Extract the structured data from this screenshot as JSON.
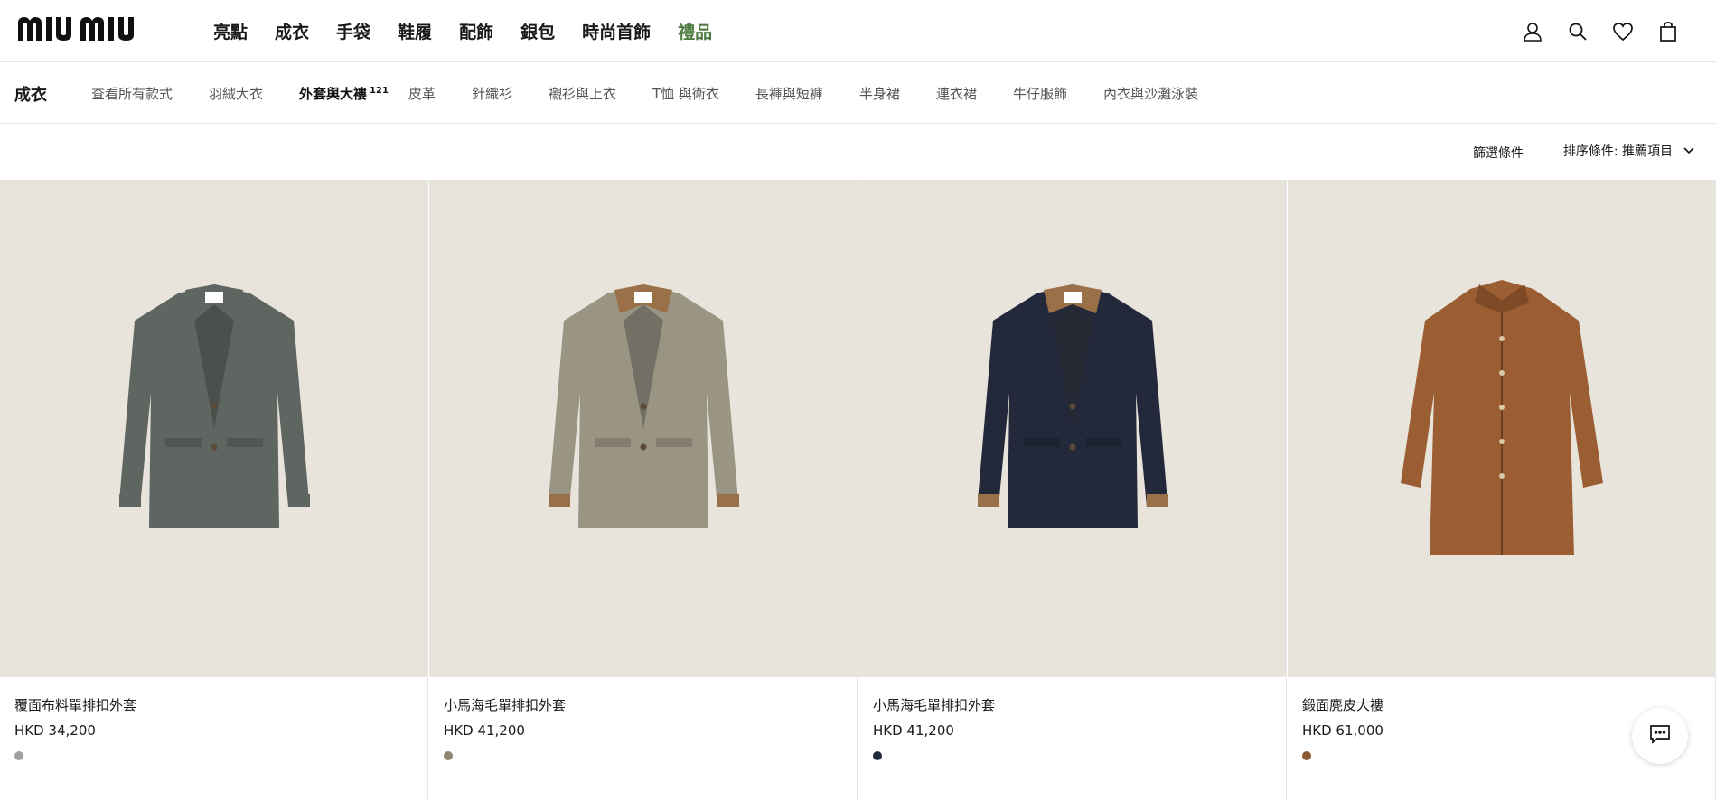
{
  "header": {
    "logo_text": "MIU MIU",
    "nav": [
      "亮點",
      "成衣",
      "手袋",
      "鞋履",
      "配飾",
      "銀包",
      "時尚首飾",
      "禮品"
    ],
    "icons": [
      "user-icon",
      "search-icon",
      "heart-icon",
      "bag-icon"
    ]
  },
  "category": {
    "title": "成衣",
    "items": [
      "查看所有款式",
      "羽絨大衣",
      "外套與大褸",
      "皮革",
      "針織衫",
      "襯衫與上衣",
      "T恤 與衛衣",
      "長褲與短褲",
      "半身裙",
      "連衣裙",
      "牛仔服飾",
      "內衣與沙灘泳裝"
    ],
    "active_count": "121"
  },
  "toolbar": {
    "filter_label": "篩選條件",
    "sort_label": "排序條件: 推薦項目"
  },
  "products": [
    {
      "name": "覆面布料單排扣外套",
      "price": "HKD 34,200",
      "swatch": "#a0a0a0",
      "garment": "#5f6560",
      "collar": "#5f6560",
      "cuff": "#5f6560"
    },
    {
      "name": "小馬海毛單排扣外套",
      "price": "HKD 41,200",
      "swatch": "#8f8672",
      "garment": "#9a9483",
      "collar": "#9a7048",
      "cuff": "#9a7048"
    },
    {
      "name": "小馬海毛單排扣外套",
      "price": "HKD 41,200",
      "swatch": "#1f2a3a",
      "garment": "#23293a",
      "collar": "#9a7048",
      "cuff": "#9a7048"
    },
    {
      "name": "鍛面麂皮大褸",
      "price": "HKD 61,000",
      "swatch": "#8b5a35",
      "garment": "#9b5e32",
      "collar": "#9b5e32",
      "cuff": "#9b5e32"
    }
  ],
  "colors": {
    "gift_nav": "#4d7a3f",
    "photo_bg": "#e8e4dc"
  }
}
